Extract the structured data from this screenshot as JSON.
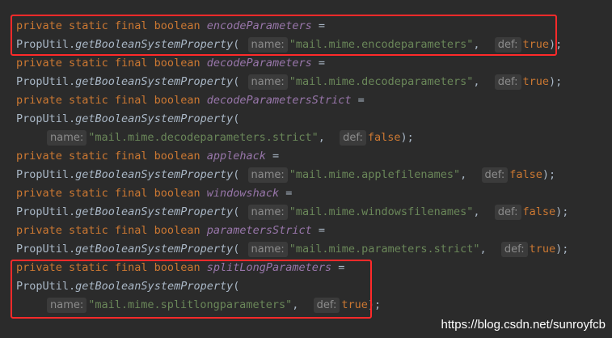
{
  "code": {
    "modifiers": "private static final boolean",
    "equals": " =",
    "util_prefix": "PropUtil.",
    "method": "getBooleanSystemProperty",
    "open_paren": "(",
    "name_hint": "name:",
    "def_hint": "def:",
    "comma": ",",
    "close": ");",
    "fields": [
      {
        "name": "encodeParameters",
        "key": "\"mail.mime.encodeparameters\"",
        "default": "true"
      },
      {
        "name": "decodeParameters",
        "key": "\"mail.mime.decodeparameters\"",
        "default": "true"
      },
      {
        "name": "decodeParametersStrict",
        "key": "\"mail.mime.decodeparameters.strict\"",
        "default": "false"
      },
      {
        "name": "applehack",
        "key": "\"mail.mime.applefilenames\"",
        "default": "false"
      },
      {
        "name": "windowshack",
        "key": "\"mail.mime.windowsfilenames\"",
        "default": "false"
      },
      {
        "name": "parametersStrict",
        "key": "\"mail.mime.parameters.strict\"",
        "default": "true"
      },
      {
        "name": "splitLongParameters",
        "key": "\"mail.mime.splitlongparameters\"",
        "default": "true"
      }
    ]
  },
  "highlight_color": "#ff2a2a",
  "watermark": "https://blog.csdn.net/sunroyfcb"
}
